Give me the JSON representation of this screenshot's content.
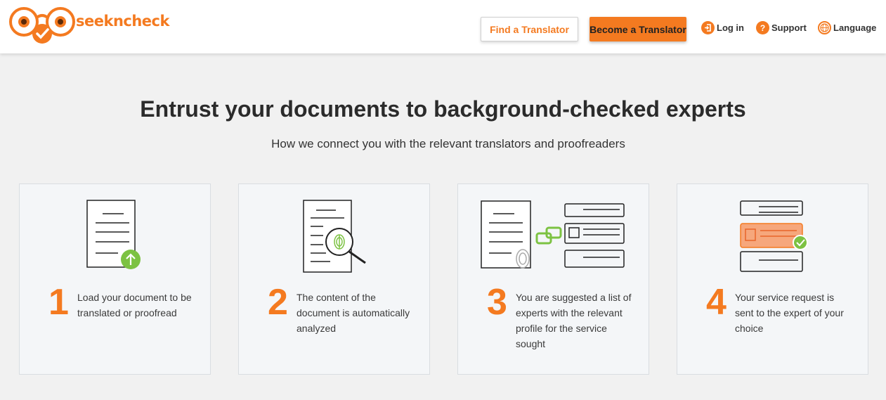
{
  "header": {
    "logo_text": "seekncheck",
    "find_translator": "Find a Translator",
    "become_translator": "Become a Translator",
    "login": "Log in",
    "support": "Support",
    "language": "Language"
  },
  "hero": {
    "title": "Entrust your documents to background-checked experts",
    "subtitle": "How we connect you with the relevant translators and proofreaders"
  },
  "steps": [
    {
      "number": "1",
      "text": "Load your document to be translated or proofread",
      "icon": "document-upload-icon"
    },
    {
      "number": "2",
      "text": "The content of the document is automatically analyzed",
      "icon": "document-analyze-icon"
    },
    {
      "number": "3",
      "text": "You are suggested a list of experts with the relevant profile for the service sought",
      "icon": "document-match-experts-icon"
    },
    {
      "number": "4",
      "text": "Your service request is sent to the expert of your choice",
      "icon": "expert-selected-icon"
    }
  ],
  "colors": {
    "accent": "#f47a20",
    "success": "#7cc242",
    "card_bg": "#f4f6f8",
    "page_bg": "#f1f1f1"
  }
}
